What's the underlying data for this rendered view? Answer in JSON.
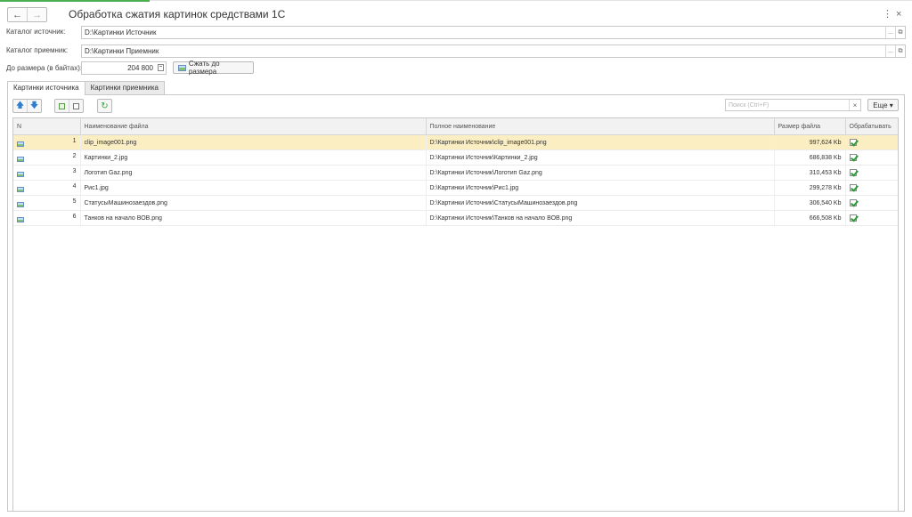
{
  "window": {
    "title": "Обработка сжатия картинок средствами 1С",
    "back_icon": "←",
    "forward_icon": "→",
    "more_icon": "⋮",
    "close_icon": "×"
  },
  "fields": {
    "source_label": "Каталог источник:",
    "source_value": "D:\\Картинки Источник",
    "target_label": "Каталог приемник:",
    "target_value": "D:\\Картинки Приемник",
    "size_label": "До размера (в байтах):",
    "size_value": "204 800",
    "compress_button": "Сжать до размера",
    "select_ellipsis": "...",
    "open_icon": "⧉"
  },
  "tabs": [
    {
      "label": "Картинки источника",
      "active": true
    },
    {
      "label": "Картинки приемника",
      "active": false
    }
  ],
  "toolbar": {
    "up_icon": "🡅",
    "down_icon": "🡇",
    "refresh_icon": "↻",
    "search_placeholder": "Поиск (Ctrl+F)",
    "search_clear": "×",
    "more_label": "Еще ▾"
  },
  "table": {
    "columns": [
      "N",
      "Наименование файла",
      "Полное наименование",
      "Размер файла",
      "Обрабатывать"
    ],
    "rows": [
      {
        "n": "1",
        "name": "clip_image001.png",
        "full": "D:\\Картинки Источник\\clip_image001.png",
        "size": "997,624 Kb",
        "process": true
      },
      {
        "n": "2",
        "name": "Картинки_2.jpg",
        "full": "D:\\Картинки Источник\\Картинки_2.jpg",
        "size": "686,838 Kb",
        "process": true
      },
      {
        "n": "3",
        "name": "Логотип Gaz.png",
        "full": "D:\\Картинки Источник\\Логотип Gaz.png",
        "size": "310,453 Kb",
        "process": true
      },
      {
        "n": "4",
        "name": "Рис1.jpg",
        "full": "D:\\Картинки Источник\\Рис1.jpg",
        "size": "299,278 Kb",
        "process": true
      },
      {
        "n": "5",
        "name": "СтатусыМашинозаездов.png",
        "full": "D:\\Картинки Источник\\СтатусыМашинозаездов.png",
        "size": "306,540 Kb",
        "process": true
      },
      {
        "n": "6",
        "name": "Танков на начало ВОВ.png",
        "full": "D:\\Картинки Источник\\Танков на начало ВОВ.png",
        "size": "666,508 Kb",
        "process": true
      }
    ]
  },
  "colors": {
    "selected_row": "#fbeec2",
    "accent_green": "#4caf50"
  }
}
